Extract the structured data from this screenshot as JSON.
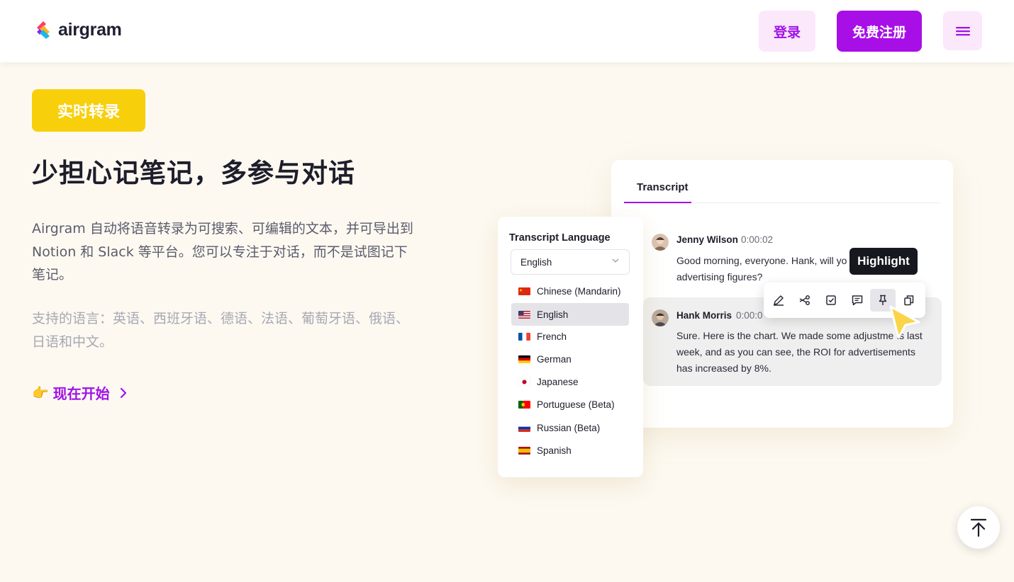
{
  "header": {
    "logo_text": "airgram",
    "login_label": "登录",
    "signup_label": "免费注册",
    "menu_icon": "hamburger-icon"
  },
  "hero": {
    "badge": "实时转录",
    "title": "少担心记笔记，多参与对话",
    "description": "Airgram 自动将语音转录为可搜索、可编辑的文本，并可导出到 Notion 和 Slack 等平台。您可以专注于对话，而不是试图记下笔记。",
    "languages": "支持的语言：英语、西班牙语、德语、法语、葡萄牙语、俄语、日语和中文。",
    "cta_emoji": "👉",
    "cta_label": "现在开始"
  },
  "transcript": {
    "tab": "Transcript",
    "messages": [
      {
        "speaker": "Jenny Wilson",
        "time": "0:00:02",
        "line1": "Good morning, everyone. Hank, will yo",
        "line2": "advertising figures?"
      },
      {
        "speaker": "Hank Morris",
        "time": "0:00:0",
        "line1": "Sure. Here is the chart. We made some adjustme   ts last",
        "line2": "week, and as you can see, the ROI for advertisements",
        "line3": "has increased by 8%."
      }
    ],
    "tooltip": "Highlight",
    "tools": [
      "edit-icon",
      "cut-icon",
      "checkbox-icon",
      "comment-icon",
      "pin-icon",
      "copy-icon"
    ]
  },
  "language_panel": {
    "title": "Transcript Language",
    "selected": "English",
    "options": [
      {
        "label": "Chinese (Mandarin)",
        "flag": "cn"
      },
      {
        "label": "English",
        "flag": "us"
      },
      {
        "label": "French",
        "flag": "fr"
      },
      {
        "label": "German",
        "flag": "de"
      },
      {
        "label": "Japanese",
        "flag": "jp"
      },
      {
        "label": "Portuguese (Beta)",
        "flag": "pt"
      },
      {
        "label": "Russian (Beta)",
        "flag": "ru"
      },
      {
        "label": "Spanish",
        "flag": "es"
      }
    ]
  },
  "colors": {
    "brand_purple": "#a80fe6",
    "badge_yellow": "#f8cf0b",
    "page_bg": "#fdf9f1"
  }
}
